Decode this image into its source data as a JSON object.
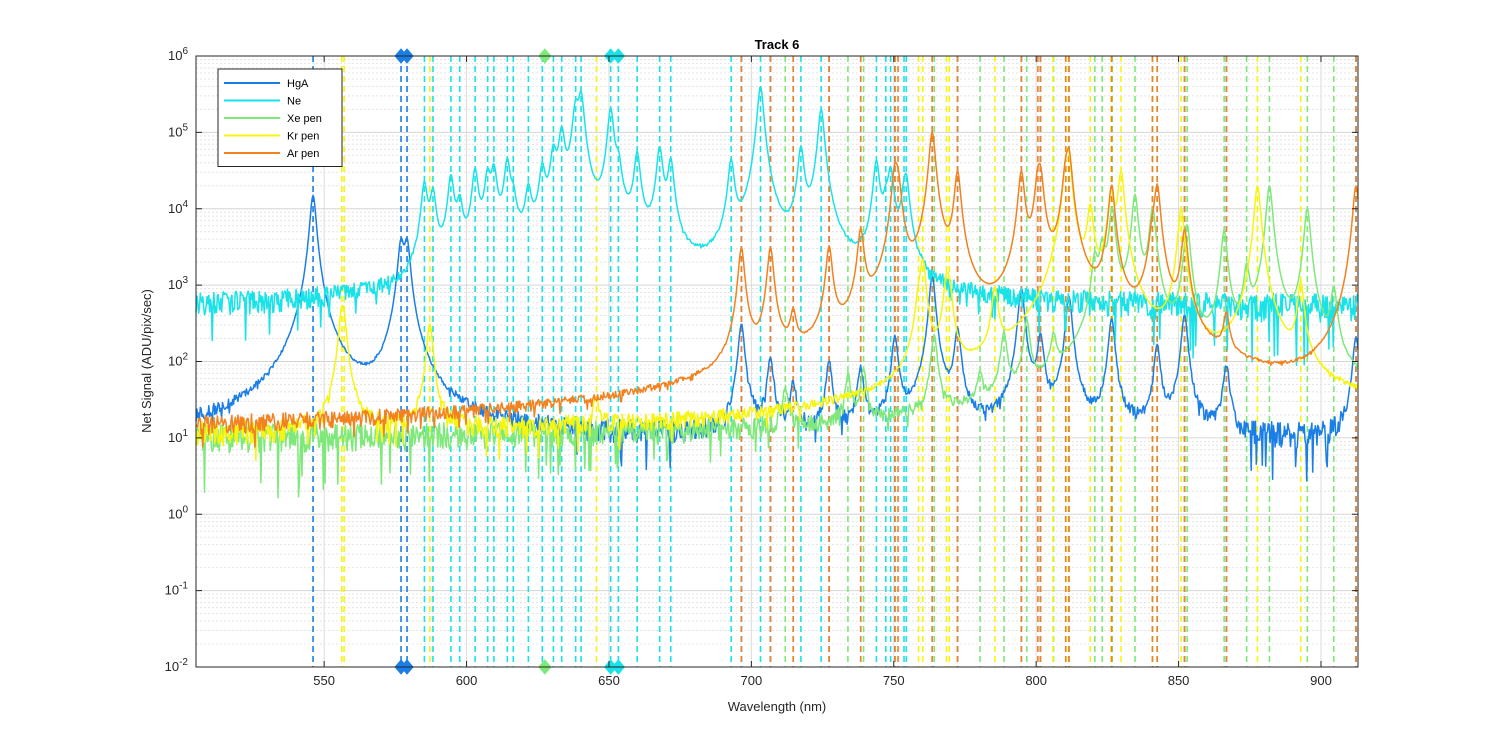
{
  "chart_data": {
    "type": "line",
    "title": "Track 6",
    "xlabel": "Wavelength (nm)",
    "ylabel": "Net Signal (ADU/pix/sec)",
    "xlim": [
      505,
      913
    ],
    "ylim": [
      0.01,
      1000000
    ],
    "y_scale": "log",
    "x_ticks": [
      550,
      600,
      650,
      700,
      750,
      800,
      850,
      900
    ],
    "x_tick_labels": [
      "550",
      "600",
      "650",
      "700",
      "750",
      "800",
      "850",
      "900"
    ],
    "y_ticks": [
      -2,
      -1,
      0,
      1,
      2,
      3,
      4,
      5,
      6
    ],
    "grid": true,
    "legend_position": "top-left",
    "series": [
      {
        "name": "HgA",
        "color": "#1a7ee6",
        "baseline": 10,
        "peaks": [
          [
            546.1,
            15000
          ],
          [
            577,
            3500
          ],
          [
            579.1,
            3500
          ],
          [
            696.5,
            300
          ],
          [
            706.7,
            100
          ],
          [
            714.7,
            40
          ],
          [
            727.3,
            90
          ],
          [
            738.4,
            70
          ],
          [
            750.4,
            200
          ],
          [
            763.5,
            1300
          ],
          [
            772.4,
            250
          ],
          [
            794.8,
            900
          ],
          [
            801.5,
            200
          ],
          [
            811.5,
            700
          ],
          [
            826.5,
            350
          ],
          [
            842.5,
            150
          ],
          [
            852.1,
            400
          ],
          [
            866.8,
            80
          ],
          [
            912.3,
            200
          ]
        ],
        "markers": [
          577,
          579.1
        ]
      },
      {
        "name": "Ne",
        "color": "#19e3e8",
        "baseline": 500,
        "peaks": [
          [
            585.2,
            20000
          ],
          [
            588.2,
            15000
          ],
          [
            594.5,
            25000
          ],
          [
            597.6,
            10000
          ],
          [
            603,
            30000
          ],
          [
            607.4,
            25000
          ],
          [
            609.6,
            30000
          ],
          [
            614.3,
            40000
          ],
          [
            616.4,
            10000
          ],
          [
            621.7,
            15000
          ],
          [
            626.6,
            30000
          ],
          [
            630.5,
            50000
          ],
          [
            633.4,
            100000
          ],
          [
            638.3,
            200000
          ],
          [
            640.2,
            300000
          ],
          [
            650.6,
            200000
          ],
          [
            653.3,
            30000
          ],
          [
            659.9,
            50000
          ],
          [
            667.8,
            60000
          ],
          [
            671.7,
            40000
          ],
          [
            692.9,
            40000
          ],
          [
            703.2,
            400000
          ],
          [
            717.4,
            60000
          ],
          [
            724.5,
            200000
          ],
          [
            743.9,
            40000
          ],
          [
            747.2,
            8000
          ],
          [
            748.9,
            30000
          ],
          [
            753.6,
            10000
          ],
          [
            754.4,
            20000
          ]
        ],
        "markers": [
          650.6,
          653.3
        ]
      },
      {
        "name": "Xe pen",
        "color": "#7fe87a",
        "baseline": 10,
        "peaks": [
          [
            711.9,
            30
          ],
          [
            733.9,
            50
          ],
          [
            739.4,
            60
          ],
          [
            764.2,
            200
          ],
          [
            780.3,
            40
          ],
          [
            788.7,
            200
          ],
          [
            796.7,
            300
          ],
          [
            806.1,
            150
          ],
          [
            820.6,
            2000
          ],
          [
            823.2,
            3000
          ],
          [
            826.7,
            10000
          ],
          [
            834.7,
            15000
          ],
          [
            840.9,
            10000
          ],
          [
            853,
            6000
          ],
          [
            866,
            5000
          ],
          [
            873.9,
            1500
          ],
          [
            881.9,
            20000
          ],
          [
            895.2,
            10000
          ],
          [
            904.5,
            800
          ]
        ],
        "markers": [
          627.5
        ]
      },
      {
        "name": "Kr pen",
        "color": "#f5f50f",
        "baseline": 10,
        "peaks": [
          [
            556.2,
            400
          ],
          [
            557,
            200
          ],
          [
            587.1,
            300
          ],
          [
            645.6,
            20
          ],
          [
            758.7,
            400
          ],
          [
            760.2,
            2000
          ],
          [
            768.5,
            1000
          ],
          [
            769.5,
            700
          ],
          [
            785.5,
            800
          ],
          [
            805.9,
            150
          ],
          [
            810.4,
            20000
          ],
          [
            811.3,
            50000
          ],
          [
            819,
            10000
          ],
          [
            826.3,
            15000
          ],
          [
            829.8,
            30000
          ],
          [
            850.9,
            10000
          ],
          [
            877.7,
            20000
          ],
          [
            892.9,
            1000
          ]
        ],
        "markers": []
      },
      {
        "name": "Ar pen",
        "color": "#f2811f",
        "baseline": 10,
        "peaks": [
          [
            696.5,
            3000
          ],
          [
            706.7,
            3000
          ],
          [
            714.7,
            300
          ],
          [
            727.3,
            3000
          ],
          [
            738.4,
            5000
          ],
          [
            750.4,
            30000
          ],
          [
            751.5,
            20000
          ],
          [
            763.5,
            100000
          ],
          [
            772.4,
            30000
          ],
          [
            794.8,
            30000
          ],
          [
            800.6,
            20000
          ],
          [
            801.5,
            25000
          ],
          [
            810.4,
            25000
          ],
          [
            811.5,
            50000
          ],
          [
            826.5,
            20000
          ],
          [
            840.8,
            3000
          ],
          [
            842.5,
            20000
          ],
          [
            852.1,
            5000
          ],
          [
            866.8,
            300
          ],
          [
            912.3,
            20000
          ]
        ],
        "markers": []
      }
    ]
  }
}
